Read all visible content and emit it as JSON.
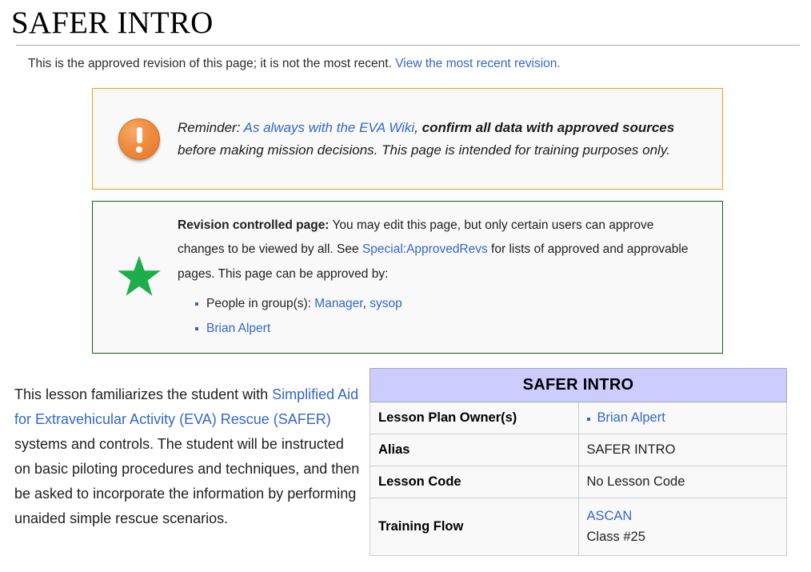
{
  "page": {
    "title": "SAFER INTRO"
  },
  "revision_notice": {
    "text": "This is the approved revision of this page; it is not the most recent.",
    "link_label": "View the most recent revision."
  },
  "reminder_box": {
    "icon": "alert-exclamation-icon",
    "label": "Reminder:",
    "link_label": "As always with the EVA Wiki",
    "comma": ",",
    "bold_text": "confirm all data with approved sources",
    "rest_text": " before making mission decisions. This page is intended for training purposes only.",
    "border_color": "#f2a100",
    "background_color": "#f9f9f9"
  },
  "revision_box": {
    "icon": "green-star-icon",
    "heading": "Revision controlled page:",
    "text_part1": " You may edit this page, but only certain users can approve changes to be viewed by all. See ",
    "link_label": "Special:ApprovedRevs",
    "text_part2": " for lists of approved and approvable pages. This page can be approved by:",
    "approvers": [
      {
        "prefix": "People in group(s): ",
        "links": [
          "Manager",
          "sysop"
        ],
        "separator": ", "
      },
      {
        "prefix": "",
        "links": [
          "Brian Alpert"
        ],
        "separator": ""
      }
    ],
    "border_color": "#046a04",
    "star_color": "#1dad4b"
  },
  "lesson_intro": {
    "text_part1": "This lesson familiarizes the student with ",
    "link_label": "Simplified Aid for Extravehicular Activity (EVA) Rescue (SAFER)",
    "text_part2": " systems and controls. The student will be instructed on basic piloting procedures and techniques, and then be asked to incorporate the information by performing unaided simple rescue scenarios."
  },
  "infobox": {
    "title": "SAFER INTRO",
    "title_background": "#ccccff",
    "rows": [
      {
        "label": "Lesson Plan Owner(s)",
        "value": "Brian Alpert",
        "is_list": true,
        "is_link": true,
        "second_value": ""
      },
      {
        "label": "Alias",
        "value": "SAFER INTRO",
        "is_list": false,
        "is_link": false,
        "second_value": ""
      },
      {
        "label": "Lesson Code",
        "value": "No Lesson Code",
        "is_list": false,
        "is_link": false,
        "second_value": ""
      },
      {
        "label": "Training Flow",
        "value": "ASCAN",
        "is_list": false,
        "is_link": true,
        "second_value": "Class #25"
      }
    ]
  },
  "colors": {
    "link": "#3366cc",
    "text": "#202020",
    "border_gray": "#a2a9b1"
  }
}
